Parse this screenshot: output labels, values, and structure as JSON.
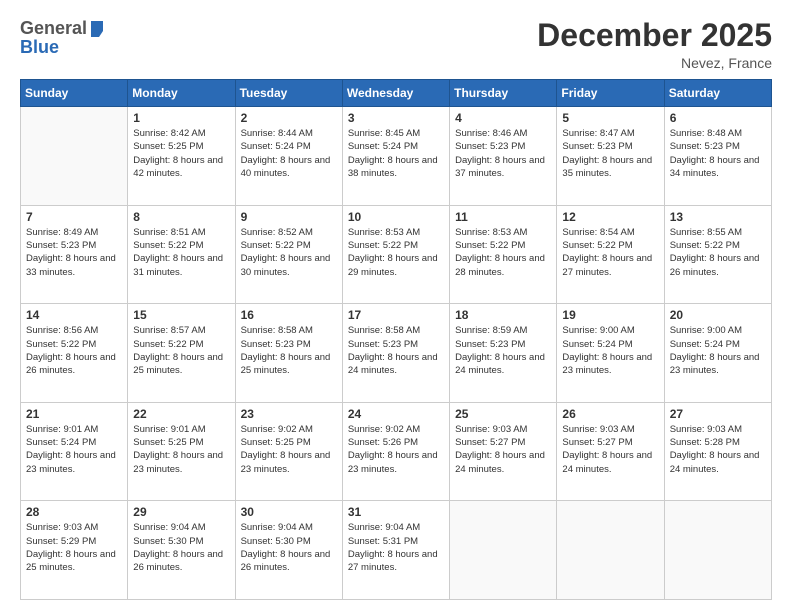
{
  "header": {
    "logo_general": "General",
    "logo_blue": "Blue",
    "month_title": "December 2025",
    "location": "Nevez, France"
  },
  "days_of_week": [
    "Sunday",
    "Monday",
    "Tuesday",
    "Wednesday",
    "Thursday",
    "Friday",
    "Saturday"
  ],
  "weeks": [
    [
      {
        "day": "",
        "info": ""
      },
      {
        "day": "1",
        "info": "Sunrise: 8:42 AM\nSunset: 5:25 PM\nDaylight: 8 hours\nand 42 minutes."
      },
      {
        "day": "2",
        "info": "Sunrise: 8:44 AM\nSunset: 5:24 PM\nDaylight: 8 hours\nand 40 minutes."
      },
      {
        "day": "3",
        "info": "Sunrise: 8:45 AM\nSunset: 5:24 PM\nDaylight: 8 hours\nand 38 minutes."
      },
      {
        "day": "4",
        "info": "Sunrise: 8:46 AM\nSunset: 5:23 PM\nDaylight: 8 hours\nand 37 minutes."
      },
      {
        "day": "5",
        "info": "Sunrise: 8:47 AM\nSunset: 5:23 PM\nDaylight: 8 hours\nand 35 minutes."
      },
      {
        "day": "6",
        "info": "Sunrise: 8:48 AM\nSunset: 5:23 PM\nDaylight: 8 hours\nand 34 minutes."
      }
    ],
    [
      {
        "day": "7",
        "info": "Sunrise: 8:49 AM\nSunset: 5:23 PM\nDaylight: 8 hours\nand 33 minutes."
      },
      {
        "day": "8",
        "info": "Sunrise: 8:51 AM\nSunset: 5:22 PM\nDaylight: 8 hours\nand 31 minutes."
      },
      {
        "day": "9",
        "info": "Sunrise: 8:52 AM\nSunset: 5:22 PM\nDaylight: 8 hours\nand 30 minutes."
      },
      {
        "day": "10",
        "info": "Sunrise: 8:53 AM\nSunset: 5:22 PM\nDaylight: 8 hours\nand 29 minutes."
      },
      {
        "day": "11",
        "info": "Sunrise: 8:53 AM\nSunset: 5:22 PM\nDaylight: 8 hours\nand 28 minutes."
      },
      {
        "day": "12",
        "info": "Sunrise: 8:54 AM\nSunset: 5:22 PM\nDaylight: 8 hours\nand 27 minutes."
      },
      {
        "day": "13",
        "info": "Sunrise: 8:55 AM\nSunset: 5:22 PM\nDaylight: 8 hours\nand 26 minutes."
      }
    ],
    [
      {
        "day": "14",
        "info": "Sunrise: 8:56 AM\nSunset: 5:22 PM\nDaylight: 8 hours\nand 26 minutes."
      },
      {
        "day": "15",
        "info": "Sunrise: 8:57 AM\nSunset: 5:22 PM\nDaylight: 8 hours\nand 25 minutes."
      },
      {
        "day": "16",
        "info": "Sunrise: 8:58 AM\nSunset: 5:23 PM\nDaylight: 8 hours\nand 25 minutes."
      },
      {
        "day": "17",
        "info": "Sunrise: 8:58 AM\nSunset: 5:23 PM\nDaylight: 8 hours\nand 24 minutes."
      },
      {
        "day": "18",
        "info": "Sunrise: 8:59 AM\nSunset: 5:23 PM\nDaylight: 8 hours\nand 24 minutes."
      },
      {
        "day": "19",
        "info": "Sunrise: 9:00 AM\nSunset: 5:24 PM\nDaylight: 8 hours\nand 23 minutes."
      },
      {
        "day": "20",
        "info": "Sunrise: 9:00 AM\nSunset: 5:24 PM\nDaylight: 8 hours\nand 23 minutes."
      }
    ],
    [
      {
        "day": "21",
        "info": "Sunrise: 9:01 AM\nSunset: 5:24 PM\nDaylight: 8 hours\nand 23 minutes."
      },
      {
        "day": "22",
        "info": "Sunrise: 9:01 AM\nSunset: 5:25 PM\nDaylight: 8 hours\nand 23 minutes."
      },
      {
        "day": "23",
        "info": "Sunrise: 9:02 AM\nSunset: 5:25 PM\nDaylight: 8 hours\nand 23 minutes."
      },
      {
        "day": "24",
        "info": "Sunrise: 9:02 AM\nSunset: 5:26 PM\nDaylight: 8 hours\nand 23 minutes."
      },
      {
        "day": "25",
        "info": "Sunrise: 9:03 AM\nSunset: 5:27 PM\nDaylight: 8 hours\nand 24 minutes."
      },
      {
        "day": "26",
        "info": "Sunrise: 9:03 AM\nSunset: 5:27 PM\nDaylight: 8 hours\nand 24 minutes."
      },
      {
        "day": "27",
        "info": "Sunrise: 9:03 AM\nSunset: 5:28 PM\nDaylight: 8 hours\nand 24 minutes."
      }
    ],
    [
      {
        "day": "28",
        "info": "Sunrise: 9:03 AM\nSunset: 5:29 PM\nDaylight: 8 hours\nand 25 minutes."
      },
      {
        "day": "29",
        "info": "Sunrise: 9:04 AM\nSunset: 5:30 PM\nDaylight: 8 hours\nand 26 minutes."
      },
      {
        "day": "30",
        "info": "Sunrise: 9:04 AM\nSunset: 5:30 PM\nDaylight: 8 hours\nand 26 minutes."
      },
      {
        "day": "31",
        "info": "Sunrise: 9:04 AM\nSunset: 5:31 PM\nDaylight: 8 hours\nand 27 minutes."
      },
      {
        "day": "",
        "info": ""
      },
      {
        "day": "",
        "info": ""
      },
      {
        "day": "",
        "info": ""
      }
    ]
  ]
}
